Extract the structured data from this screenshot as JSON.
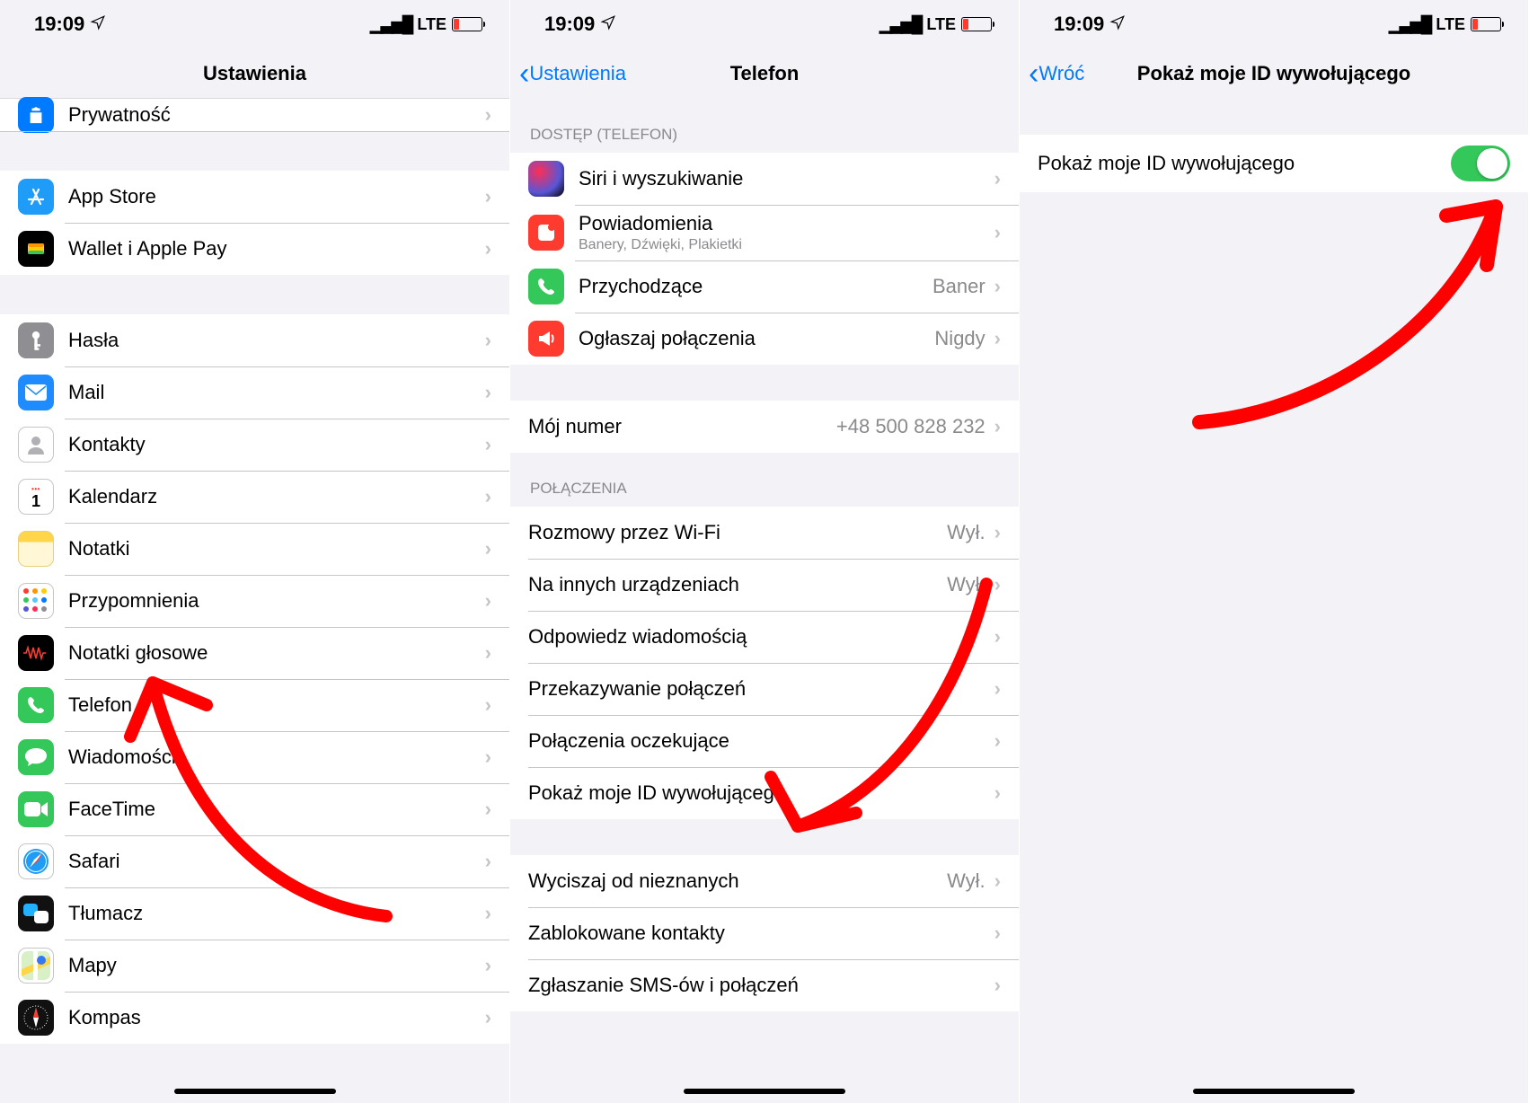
{
  "status": {
    "time": "19:09",
    "network": "LTE"
  },
  "screen1": {
    "title": "Ustawienia",
    "peek": "Prywatność",
    "group1": [
      {
        "icon": "appstore",
        "label": "App Store"
      },
      {
        "icon": "wallet",
        "label": "Wallet i Apple Pay"
      }
    ],
    "group2": [
      {
        "icon": "passwords",
        "label": "Hasła"
      },
      {
        "icon": "mail",
        "label": "Mail"
      },
      {
        "icon": "contacts",
        "label": "Kontakty"
      },
      {
        "icon": "calendar",
        "label": "Kalendarz"
      },
      {
        "icon": "notes",
        "label": "Notatki"
      },
      {
        "icon": "reminders",
        "label": "Przypomnienia"
      },
      {
        "icon": "voicememo",
        "label": "Notatki głosowe"
      },
      {
        "icon": "phone",
        "label": "Telefon"
      },
      {
        "icon": "messages",
        "label": "Wiadomości"
      },
      {
        "icon": "facetime",
        "label": "FaceTime"
      },
      {
        "icon": "safari",
        "label": "Safari"
      },
      {
        "icon": "translate",
        "label": "Tłumacz"
      },
      {
        "icon": "maps",
        "label": "Mapy"
      },
      {
        "icon": "compass",
        "label": "Kompas"
      }
    ]
  },
  "screen2": {
    "back": "Ustawienia",
    "title": "Telefon",
    "section_access": "DOSTĘP (TELEFON)",
    "access_rows": [
      {
        "icon": "siri",
        "label": "Siri i wyszukiwanie"
      },
      {
        "icon": "notif",
        "label": "Powiadomienia",
        "sub": "Banery, Dźwięki, Plakietki"
      },
      {
        "icon": "incoming",
        "label": "Przychodzące",
        "value": "Baner"
      },
      {
        "icon": "announce",
        "label": "Ogłaszaj połączenia",
        "value": "Nigdy"
      }
    ],
    "my_number_label": "Mój numer",
    "my_number_value": "+48 500 828 232",
    "section_calls": "POŁĄCZENIA",
    "calls_rows": [
      {
        "label": "Rozmowy przez Wi-Fi",
        "value": "Wył."
      },
      {
        "label": "Na innych urządzeniach",
        "value": "Wył."
      },
      {
        "label": "Odpowiedz wiadomością"
      },
      {
        "label": "Przekazywanie połączeń"
      },
      {
        "label": "Połączenia oczekujące"
      },
      {
        "label": "Pokaż moje ID wywołującego"
      }
    ],
    "tail_rows": [
      {
        "label": "Wyciszaj od nieznanych",
        "value": "Wył."
      },
      {
        "label": "Zablokowane kontakty"
      },
      {
        "label": "Zgłaszanie SMS-ów i połączeń"
      }
    ]
  },
  "screen3": {
    "back": "Wróć",
    "title": "Pokaż moje ID wywołującego",
    "row_label": "Pokaż moje ID wywołującego",
    "toggle_on": true
  }
}
